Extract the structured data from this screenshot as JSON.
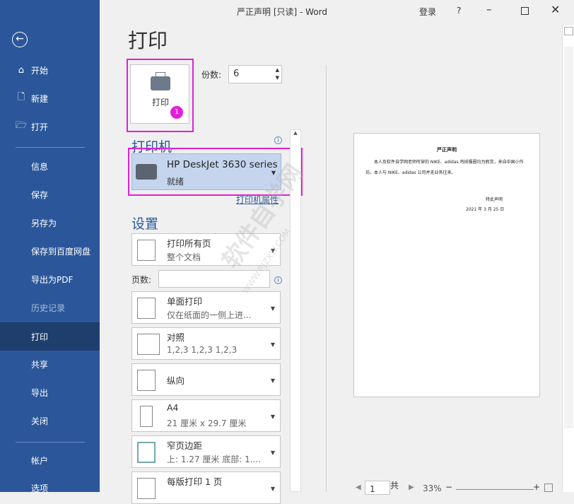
{
  "window": {
    "title": "严正声明 [只读]  -  Word",
    "login": "登录",
    "help": "?"
  },
  "sidebar": {
    "items": [
      {
        "label": "开始",
        "icon": "home-icon"
      },
      {
        "label": "新建",
        "icon": "new-doc-icon"
      },
      {
        "label": "打开",
        "icon": "folder-open-icon"
      },
      {
        "label": "信息"
      },
      {
        "label": "保存"
      },
      {
        "label": "另存为"
      },
      {
        "label": "保存到百度网盘"
      },
      {
        "label": "导出为PDF"
      },
      {
        "label": "历史记录",
        "disabled": true
      },
      {
        "label": "打印",
        "selected": true
      },
      {
        "label": "共享"
      },
      {
        "label": "导出"
      },
      {
        "label": "关闭"
      },
      {
        "label": "帐户"
      },
      {
        "label": "选项"
      }
    ]
  },
  "print": {
    "heading": "打印",
    "print_button": "打印",
    "badge": "1",
    "copies_label": "份数:",
    "copies_value": "6",
    "printer_heading": "打印机",
    "printer_name": "HP DeskJet 3630 series",
    "printer_status": "就绪",
    "printer_props": "打印机属性",
    "settings_heading": "设置",
    "pages_label": "页数:",
    "pages_value": "",
    "options": [
      {
        "l1": "打印所有页",
        "l2": "整个文档"
      },
      {
        "l1": "单面打印",
        "l2": "仅在纸面的一侧上进..."
      },
      {
        "l1": "对照",
        "l2": "1,2,3    1,2,3    1,2,3"
      },
      {
        "l1": "纵向",
        "l2": ""
      },
      {
        "l1": "A4",
        "l2": "21 厘米 x 29.7 厘米"
      },
      {
        "l1": "窄页边距",
        "l2": "上: 1.27 厘米 底部: 1...."
      },
      {
        "l1": "每版打印 1 页",
        "l2": ""
      }
    ]
  },
  "preview": {
    "doc_title": "严正声明",
    "body": "本人及软件自学网老师所穿的 NIKE、adidas 鸡排骚圈均为假货，来自中国小作坊。本人与 NIKE、adidas 公司并无业务往来。",
    "signature": "特此声明",
    "date": "2021 年 3 月 25 日",
    "page_value": "1",
    "page_total_label": "共",
    "zoom": "33%"
  },
  "watermark": {
    "text": "软件自学网",
    "url": "WWW.RJZXW.COM"
  },
  "colors": {
    "sidebar": "#2b579a",
    "highlight": "#e020d8"
  }
}
